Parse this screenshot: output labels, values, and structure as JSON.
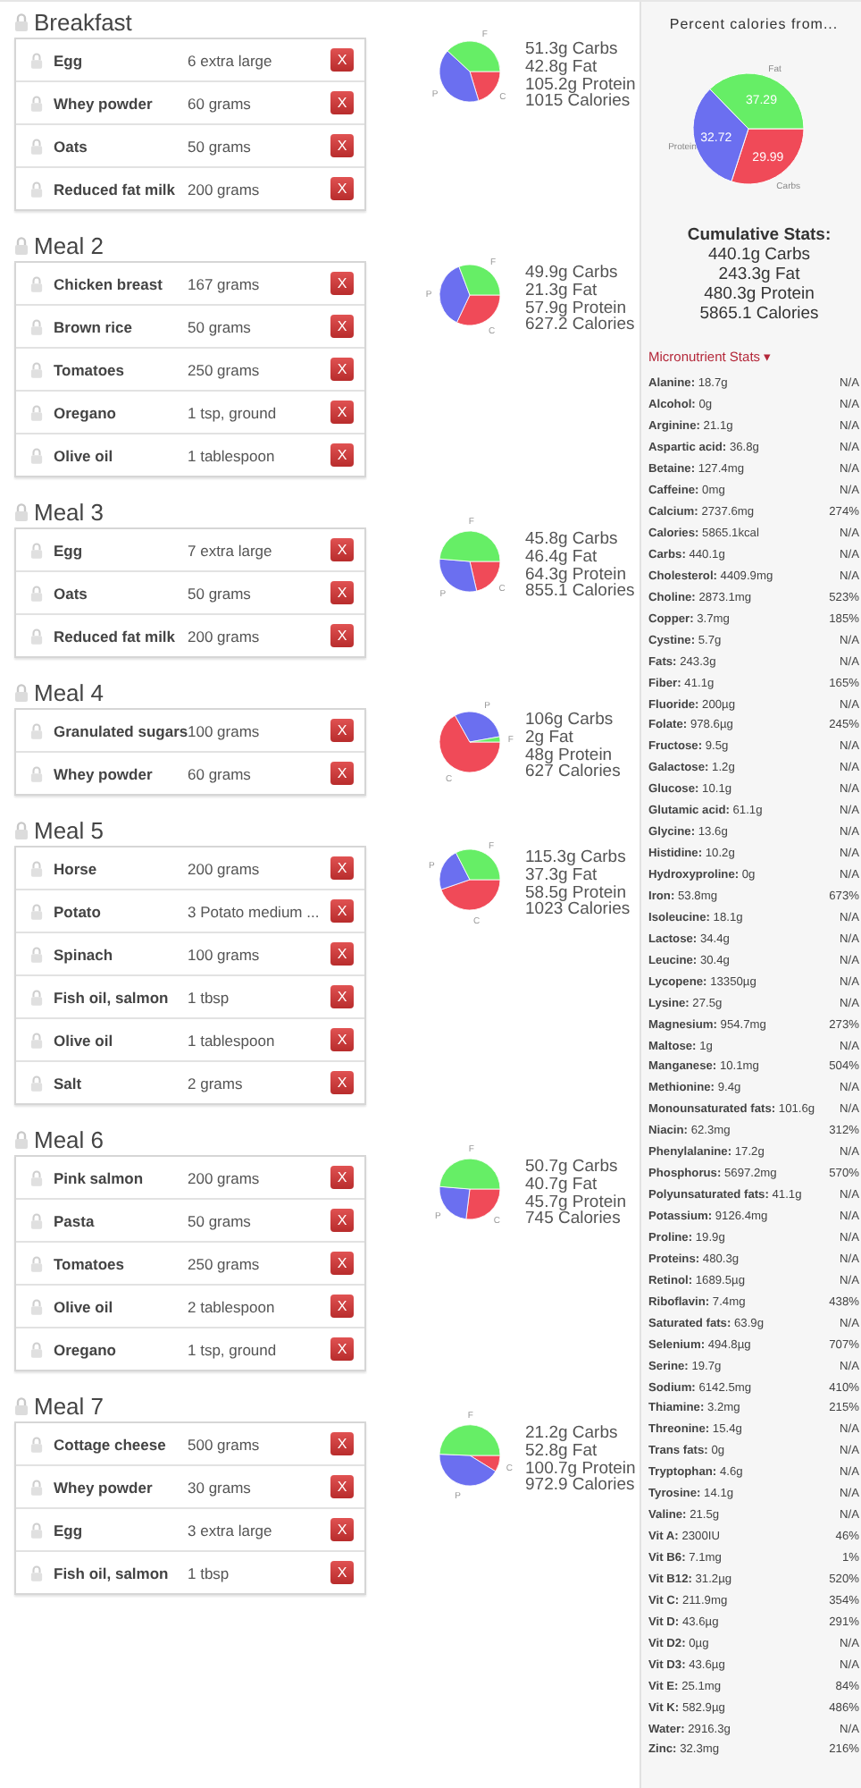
{
  "meals": [
    {
      "title": "Breakfast",
      "foods": [
        {
          "name": "Egg",
          "amount": "6 extra large",
          "delete": "X"
        },
        {
          "name": "Whey powder",
          "amount": "60 grams",
          "delete": "X"
        },
        {
          "name": "Oats",
          "amount": "50 grams",
          "delete": "X"
        },
        {
          "name": "Reduced fat milk",
          "amount": "200 grams",
          "delete": "X"
        }
      ],
      "pie_labels": {
        "fat": "F",
        "protein": "P",
        "carbs": "C"
      },
      "macros": {
        "carbs": "51.3g Carbs",
        "fat": "42.8g Fat",
        "protein": "105.2g Protein",
        "calories": "1015 Calories"
      }
    },
    {
      "title": "Meal 2",
      "foods": [
        {
          "name": "Chicken breast",
          "amount": "167 grams",
          "delete": "X"
        },
        {
          "name": "Brown rice",
          "amount": "50 grams",
          "delete": "X"
        },
        {
          "name": "Tomatoes",
          "amount": "250 grams",
          "delete": "X"
        },
        {
          "name": "Oregano",
          "amount": "1 tsp, ground",
          "delete": "X"
        },
        {
          "name": "Olive oil",
          "amount": "1 tablespoon",
          "delete": "X"
        }
      ],
      "pie_labels": {
        "fat": "F",
        "protein": "P",
        "carbs": "C"
      },
      "macros": {
        "carbs": "49.9g Carbs",
        "fat": "21.3g Fat",
        "protein": "57.9g Protein",
        "calories": "627.2 Calories"
      }
    },
    {
      "title": "Meal 3",
      "foods": [
        {
          "name": "Egg",
          "amount": "7 extra large",
          "delete": "X"
        },
        {
          "name": "Oats",
          "amount": "50 grams",
          "delete": "X"
        },
        {
          "name": "Reduced fat milk",
          "amount": "200 grams",
          "delete": "X"
        }
      ],
      "pie_labels": {
        "fat": "F",
        "protein": "P",
        "carbs": "C"
      },
      "macros": {
        "carbs": "45.8g Carbs",
        "fat": "46.4g Fat",
        "protein": "64.3g Protein",
        "calories": "855.1 Calories"
      }
    },
    {
      "title": "Meal 4",
      "foods": [
        {
          "name": "Granulated sugars",
          "amount": "100 grams",
          "delete": "X"
        },
        {
          "name": "Whey powder",
          "amount": "60 grams",
          "delete": "X"
        }
      ],
      "pie_labels": {
        "fat": "F",
        "protein": "P",
        "carbs": "C"
      },
      "macros": {
        "carbs": "106g Carbs",
        "fat": "2g Fat",
        "protein": "48g Protein",
        "calories": "627 Calories"
      }
    },
    {
      "title": "Meal 5",
      "foods": [
        {
          "name": "Horse",
          "amount": "200 grams",
          "delete": "X"
        },
        {
          "name": "Potato",
          "amount": "3 Potato medium ...",
          "delete": "X"
        },
        {
          "name": "Spinach",
          "amount": "100 grams",
          "delete": "X"
        },
        {
          "name": "Fish oil, salmon",
          "amount": "1 tbsp",
          "delete": "X"
        },
        {
          "name": "Olive oil",
          "amount": "1 tablespoon",
          "delete": "X"
        },
        {
          "name": "Salt",
          "amount": "2 grams",
          "delete": "X"
        }
      ],
      "pie_labels": {
        "fat": "F",
        "protein": "P",
        "carbs": "C"
      },
      "macros": {
        "carbs": "115.3g Carbs",
        "fat": "37.3g Fat",
        "protein": "58.5g Protein",
        "calories": "1023 Calories"
      }
    },
    {
      "title": "Meal 6",
      "foods": [
        {
          "name": "Pink salmon",
          "amount": "200 grams",
          "delete": "X"
        },
        {
          "name": "Pasta",
          "amount": "50 grams",
          "delete": "X"
        },
        {
          "name": "Tomatoes",
          "amount": "250 grams",
          "delete": "X"
        },
        {
          "name": "Olive oil",
          "amount": "2 tablespoon",
          "delete": "X"
        },
        {
          "name": "Oregano",
          "amount": "1 tsp, ground",
          "delete": "X"
        }
      ],
      "pie_labels": {
        "fat": "F",
        "protein": "P",
        "carbs": "C"
      },
      "macros": {
        "carbs": "50.7g Carbs",
        "fat": "40.7g Fat",
        "protein": "45.7g Protein",
        "calories": "745 Calories"
      }
    },
    {
      "title": "Meal 7",
      "foods": [
        {
          "name": "Cottage cheese",
          "amount": "500 grams",
          "delete": "X"
        },
        {
          "name": "Whey powder",
          "amount": "30 grams",
          "delete": "X"
        },
        {
          "name": "Egg",
          "amount": "3 extra large",
          "delete": "X"
        },
        {
          "name": "Fish oil, salmon",
          "amount": "1 tbsp",
          "delete": "X"
        }
      ],
      "pie_labels": {
        "fat": "F",
        "protein": "P",
        "carbs": "C"
      },
      "macros": {
        "carbs": "21.2g Carbs",
        "fat": "52.8g Fat",
        "protein": "100.7g Protein",
        "calories": "972.9 Calories"
      }
    }
  ],
  "sidebar": {
    "chart_data": {
      "type": "pie",
      "title": "Percent calories from...",
      "categories": [
        "Carbs",
        "Protein",
        "Fat"
      ],
      "values": [
        29.99,
        32.72,
        37.29
      ],
      "data_labels": true
    },
    "cumulative": {
      "title": "Cumulative Stats:",
      "lines": [
        "440.1g Carbs",
        "243.3g Fat",
        "480.3g Protein",
        "5865.1 Calories"
      ]
    },
    "micronutrients": {
      "title": "Micronutrient Stats",
      "toggle": "▾",
      "rows": [
        {
          "name": "Alanine:",
          "value": "18.7g",
          "dv": "N/A"
        },
        {
          "name": "Alcohol:",
          "value": "0g",
          "dv": "N/A"
        },
        {
          "name": "Arginine:",
          "value": "21.1g",
          "dv": "N/A"
        },
        {
          "name": "Aspartic acid:",
          "value": "36.8g",
          "dv": "N/A"
        },
        {
          "name": "Betaine:",
          "value": "127.4mg",
          "dv": "N/A"
        },
        {
          "name": "Caffeine:",
          "value": "0mg",
          "dv": "N/A"
        },
        {
          "name": "Calcium:",
          "value": "2737.6mg",
          "dv": "274%"
        },
        {
          "name": "Calories:",
          "value": "5865.1kcal",
          "dv": "N/A"
        },
        {
          "name": "Carbs:",
          "value": "440.1g",
          "dv": "N/A"
        },
        {
          "name": "Cholesterol:",
          "value": "4409.9mg",
          "dv": "N/A"
        },
        {
          "name": "Choline:",
          "value": "2873.1mg",
          "dv": "523%"
        },
        {
          "name": "Copper:",
          "value": "3.7mg",
          "dv": "185%"
        },
        {
          "name": "Cystine:",
          "value": "5.7g",
          "dv": "N/A"
        },
        {
          "name": "Fats:",
          "value": "243.3g",
          "dv": "N/A"
        },
        {
          "name": "Fiber:",
          "value": "41.1g",
          "dv": "165%"
        },
        {
          "name": "Fluoride:",
          "value": "200µg",
          "dv": "N/A"
        },
        {
          "name": "Folate:",
          "value": "978.6µg",
          "dv": "245%"
        },
        {
          "name": "Fructose:",
          "value": "9.5g",
          "dv": "N/A"
        },
        {
          "name": "Galactose:",
          "value": "1.2g",
          "dv": "N/A"
        },
        {
          "name": "Glucose:",
          "value": "10.1g",
          "dv": "N/A"
        },
        {
          "name": "Glutamic acid:",
          "value": "61.1g",
          "dv": "N/A"
        },
        {
          "name": "Glycine:",
          "value": "13.6g",
          "dv": "N/A"
        },
        {
          "name": "Histidine:",
          "value": "10.2g",
          "dv": "N/A"
        },
        {
          "name": "Hydroxyproline:",
          "value": "0g",
          "dv": "N/A"
        },
        {
          "name": "Iron:",
          "value": "53.8mg",
          "dv": "673%"
        },
        {
          "name": "Isoleucine:",
          "value": "18.1g",
          "dv": "N/A"
        },
        {
          "name": "Lactose:",
          "value": "34.4g",
          "dv": "N/A"
        },
        {
          "name": "Leucine:",
          "value": "30.4g",
          "dv": "N/A"
        },
        {
          "name": "Lycopene:",
          "value": "13350µg",
          "dv": "N/A"
        },
        {
          "name": "Lysine:",
          "value": "27.5g",
          "dv": "N/A"
        },
        {
          "name": "Magnesium:",
          "value": "954.7mg",
          "dv": "273%"
        },
        {
          "name": "Maltose:",
          "value": "1g",
          "dv": "N/A"
        },
        {
          "name": "Manganese:",
          "value": "10.1mg",
          "dv": "504%"
        },
        {
          "name": "Methionine:",
          "value": "9.4g",
          "dv": "N/A"
        },
        {
          "name": "Monounsaturated fats:",
          "value": "101.6g",
          "dv": "N/A"
        },
        {
          "name": "Niacin:",
          "value": "62.3mg",
          "dv": "312%"
        },
        {
          "name": "Phenylalanine:",
          "value": "17.2g",
          "dv": "N/A"
        },
        {
          "name": "Phosphorus:",
          "value": "5697.2mg",
          "dv": "570%"
        },
        {
          "name": "Polyunsaturated fats:",
          "value": "41.1g",
          "dv": "N/A"
        },
        {
          "name": "Potassium:",
          "value": "9126.4mg",
          "dv": "N/A"
        },
        {
          "name": "Proline:",
          "value": "19.9g",
          "dv": "N/A"
        },
        {
          "name": "Proteins:",
          "value": "480.3g",
          "dv": "N/A"
        },
        {
          "name": "Retinol:",
          "value": "1689.5µg",
          "dv": "N/A"
        },
        {
          "name": "Riboflavin:",
          "value": "7.4mg",
          "dv": "438%"
        },
        {
          "name": "Saturated fats:",
          "value": "63.9g",
          "dv": "N/A"
        },
        {
          "name": "Selenium:",
          "value": "494.8µg",
          "dv": "707%"
        },
        {
          "name": "Serine:",
          "value": "19.7g",
          "dv": "N/A"
        },
        {
          "name": "Sodium:",
          "value": "6142.5mg",
          "dv": "410%"
        },
        {
          "name": "Thiamine:",
          "value": "3.2mg",
          "dv": "215%"
        },
        {
          "name": "Threonine:",
          "value": "15.4g",
          "dv": "N/A"
        },
        {
          "name": "Trans fats:",
          "value": "0g",
          "dv": "N/A"
        },
        {
          "name": "Tryptophan:",
          "value": "4.6g",
          "dv": "N/A"
        },
        {
          "name": "Tyrosine:",
          "value": "14.1g",
          "dv": "N/A"
        },
        {
          "name": "Valine:",
          "value": "21.5g",
          "dv": "N/A"
        },
        {
          "name": "Vit A:",
          "value": "2300IU",
          "dv": "46%"
        },
        {
          "name": "Vit B6:",
          "value": "7.1mg",
          "dv": "1%"
        },
        {
          "name": "Vit B12:",
          "value": "31.2µg",
          "dv": "520%"
        },
        {
          "name": "Vit C:",
          "value": "211.9mg",
          "dv": "354%"
        },
        {
          "name": "Vit D:",
          "value": "43.6µg",
          "dv": "291%"
        },
        {
          "name": "Vit D2:",
          "value": "0µg",
          "dv": "N/A"
        },
        {
          "name": "Vit D3:",
          "value": "43.6µg",
          "dv": "N/A"
        },
        {
          "name": "Vit E:",
          "value": "25.1mg",
          "dv": "84%"
        },
        {
          "name": "Vit K:",
          "value": "582.9µg",
          "dv": "486%"
        },
        {
          "name": "Water:",
          "value": "2916.3g",
          "dv": "N/A"
        },
        {
          "name": "Zinc:",
          "value": "32.3mg",
          "dv": "216%"
        }
      ]
    }
  }
}
